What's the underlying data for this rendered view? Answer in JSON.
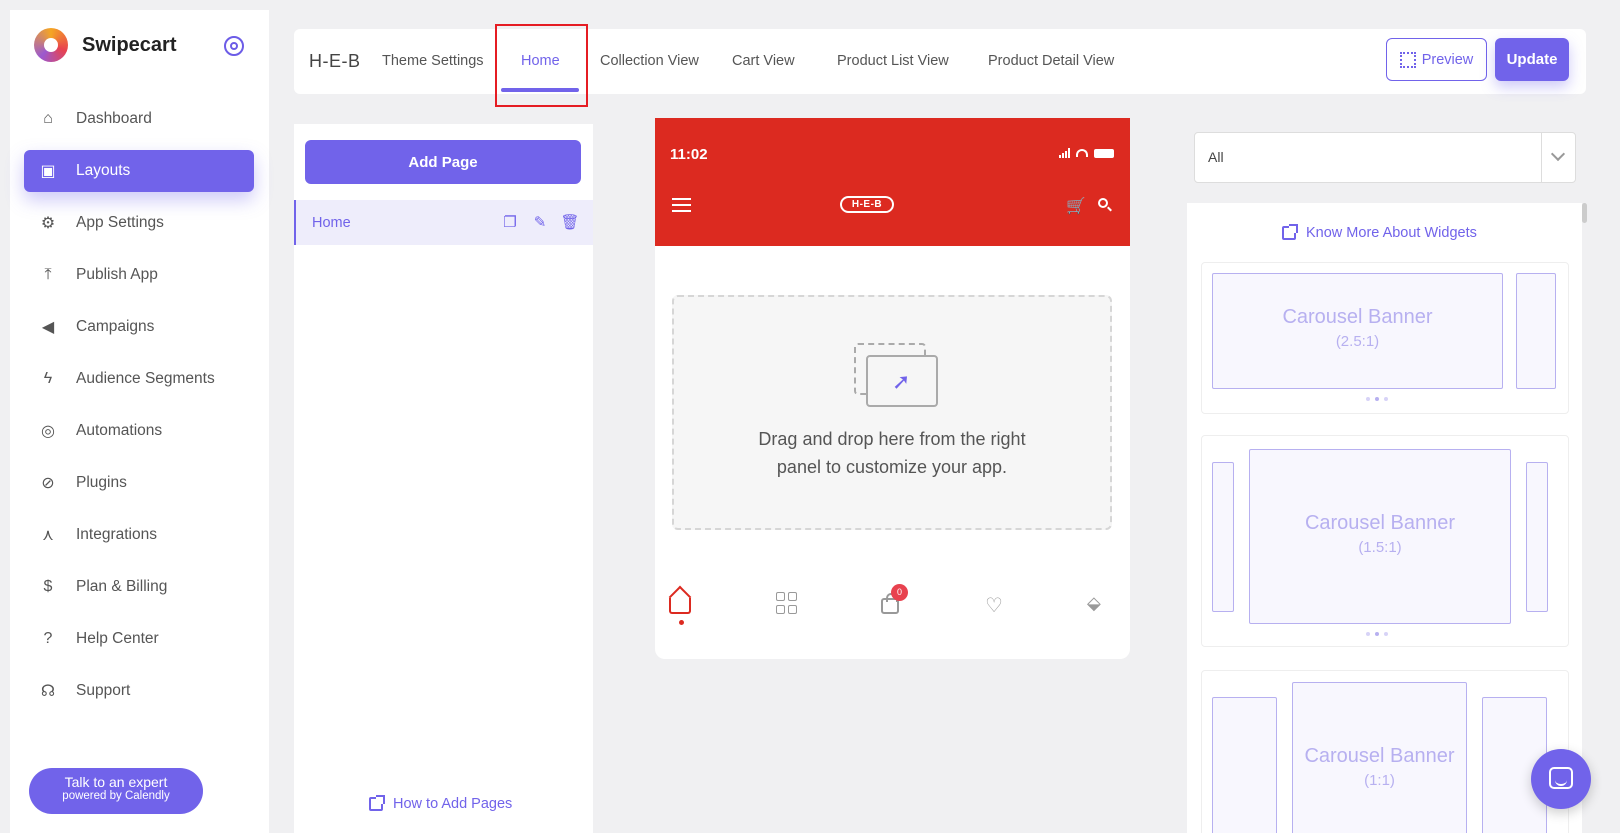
{
  "sidebar": {
    "brand": "Swipecart",
    "items": [
      {
        "label": "Dashboard",
        "icon": "home-icon"
      },
      {
        "label": "Layouts",
        "icon": "layouts-icon",
        "active": true
      },
      {
        "label": "App Settings",
        "icon": "gear-icon"
      },
      {
        "label": "Publish App",
        "icon": "upload-icon"
      },
      {
        "label": "Campaigns",
        "icon": "megaphone-icon"
      },
      {
        "label": "Audience Segments",
        "icon": "lightning-icon"
      },
      {
        "label": "Automations",
        "icon": "automation-icon"
      },
      {
        "label": "Plugins",
        "icon": "plug-icon"
      },
      {
        "label": "Integrations",
        "icon": "network-icon"
      },
      {
        "label": "Plan & Billing",
        "icon": "billing-icon"
      },
      {
        "label": "Help Center",
        "icon": "help-icon"
      },
      {
        "label": "Support",
        "icon": "headset-icon"
      }
    ],
    "expert": {
      "line1": "Talk to an expert",
      "line2": "powered by Calendly"
    }
  },
  "topbar": {
    "store": "H-E-B",
    "tabs": [
      "Theme Settings",
      "Home",
      "Collection View",
      "Cart View",
      "Product List View",
      "Product Detail View"
    ],
    "active_tab": "Home",
    "preview_label": "Preview",
    "update_label": "Update"
  },
  "pages": {
    "add_label": "Add Page",
    "list": [
      {
        "label": "Home"
      }
    ],
    "how_link": "How to Add Pages"
  },
  "phone": {
    "time": "11:02",
    "logo": "H-E-B",
    "drop_text_line1": "Drag and drop here from the right",
    "drop_text_line2": "panel to customize your app.",
    "cart_badge": "0"
  },
  "widgets": {
    "filter_value": "All",
    "know_more": "Know More About Widgets",
    "cards": [
      {
        "title": "Carousel Banner",
        "ratio": "(2.5:1)"
      },
      {
        "title": "Carousel Banner",
        "ratio": "(1.5:1)"
      },
      {
        "title": "Carousel Banner",
        "ratio": "(1:1)"
      }
    ]
  },
  "colors": {
    "accent": "#7163ea",
    "brand_red": "#dc2a20",
    "highlight": "#e51c23"
  }
}
